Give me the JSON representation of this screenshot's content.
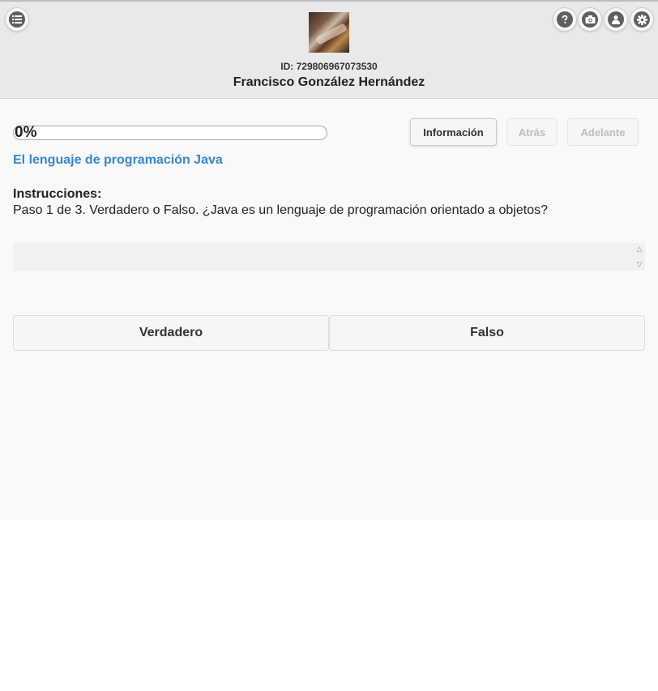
{
  "header": {
    "id_label": "ID: 729806967073530",
    "user_name": "Francisco González Hernández",
    "icons": {
      "menu": "list-icon",
      "help": "help-icon",
      "camera": "camera-icon",
      "user": "user-icon",
      "settings": "gear-icon"
    }
  },
  "progress": {
    "text": "0%",
    "value": 0
  },
  "nav": {
    "info_label": "Información",
    "back_label": "Atrás",
    "next_label": "Adelante"
  },
  "course": {
    "title": "El lenguaje de programación Java"
  },
  "instructions": {
    "label": "Instrucciones:",
    "text": "Paso 1 de 3. Verdadero o Falso. ¿Java es un lenguaje de programación orientado a objetos?"
  },
  "choices": {
    "true_label": "Verdadero",
    "false_label": "Falso"
  },
  "colors": {
    "accent": "#3388cc",
    "header_bg": "#e9e9e9",
    "content_bg": "#f9f9f9"
  }
}
